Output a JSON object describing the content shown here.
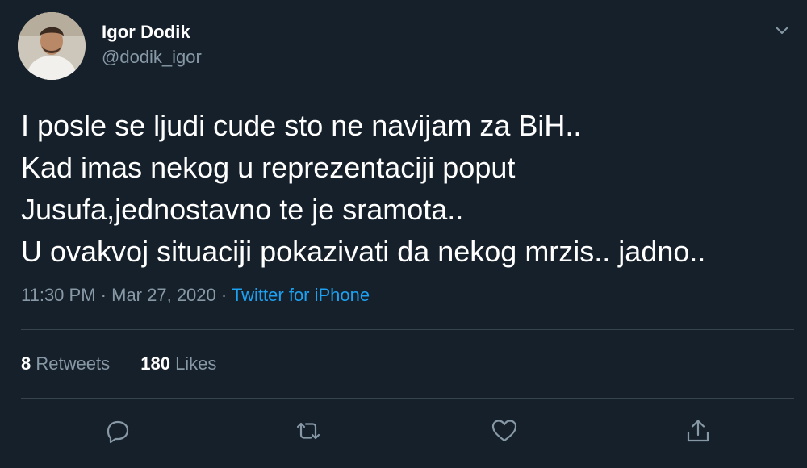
{
  "author": {
    "name": "Igor Dodik",
    "handle": "@dodik_igor"
  },
  "tweet": {
    "text": "I posle se ljudi cude sto ne navijam za BiH..\nKad imas nekog u reprezentaciji poput\nJusufa,jednostavno te je sramota..\nU ovakvoj situaciji pokazivati da nekog mrzis.. jadno..",
    "time": "11:30 PM",
    "separator1": "·",
    "date": "Mar 27, 2020",
    "separator2": "·",
    "source": "Twitter for iPhone"
  },
  "stats": {
    "retweets_count": "8",
    "retweets_label": "Retweets",
    "likes_count": "180",
    "likes_label": "Likes"
  },
  "icons": {
    "caret": "chevron-down-icon",
    "reply": "reply-icon",
    "retweet": "retweet-icon",
    "like": "heart-icon",
    "share": "share-icon"
  },
  "colors": {
    "background": "#15202b",
    "secondary_text": "#8899a6",
    "link": "#1da1f2",
    "divider": "#38444d"
  }
}
